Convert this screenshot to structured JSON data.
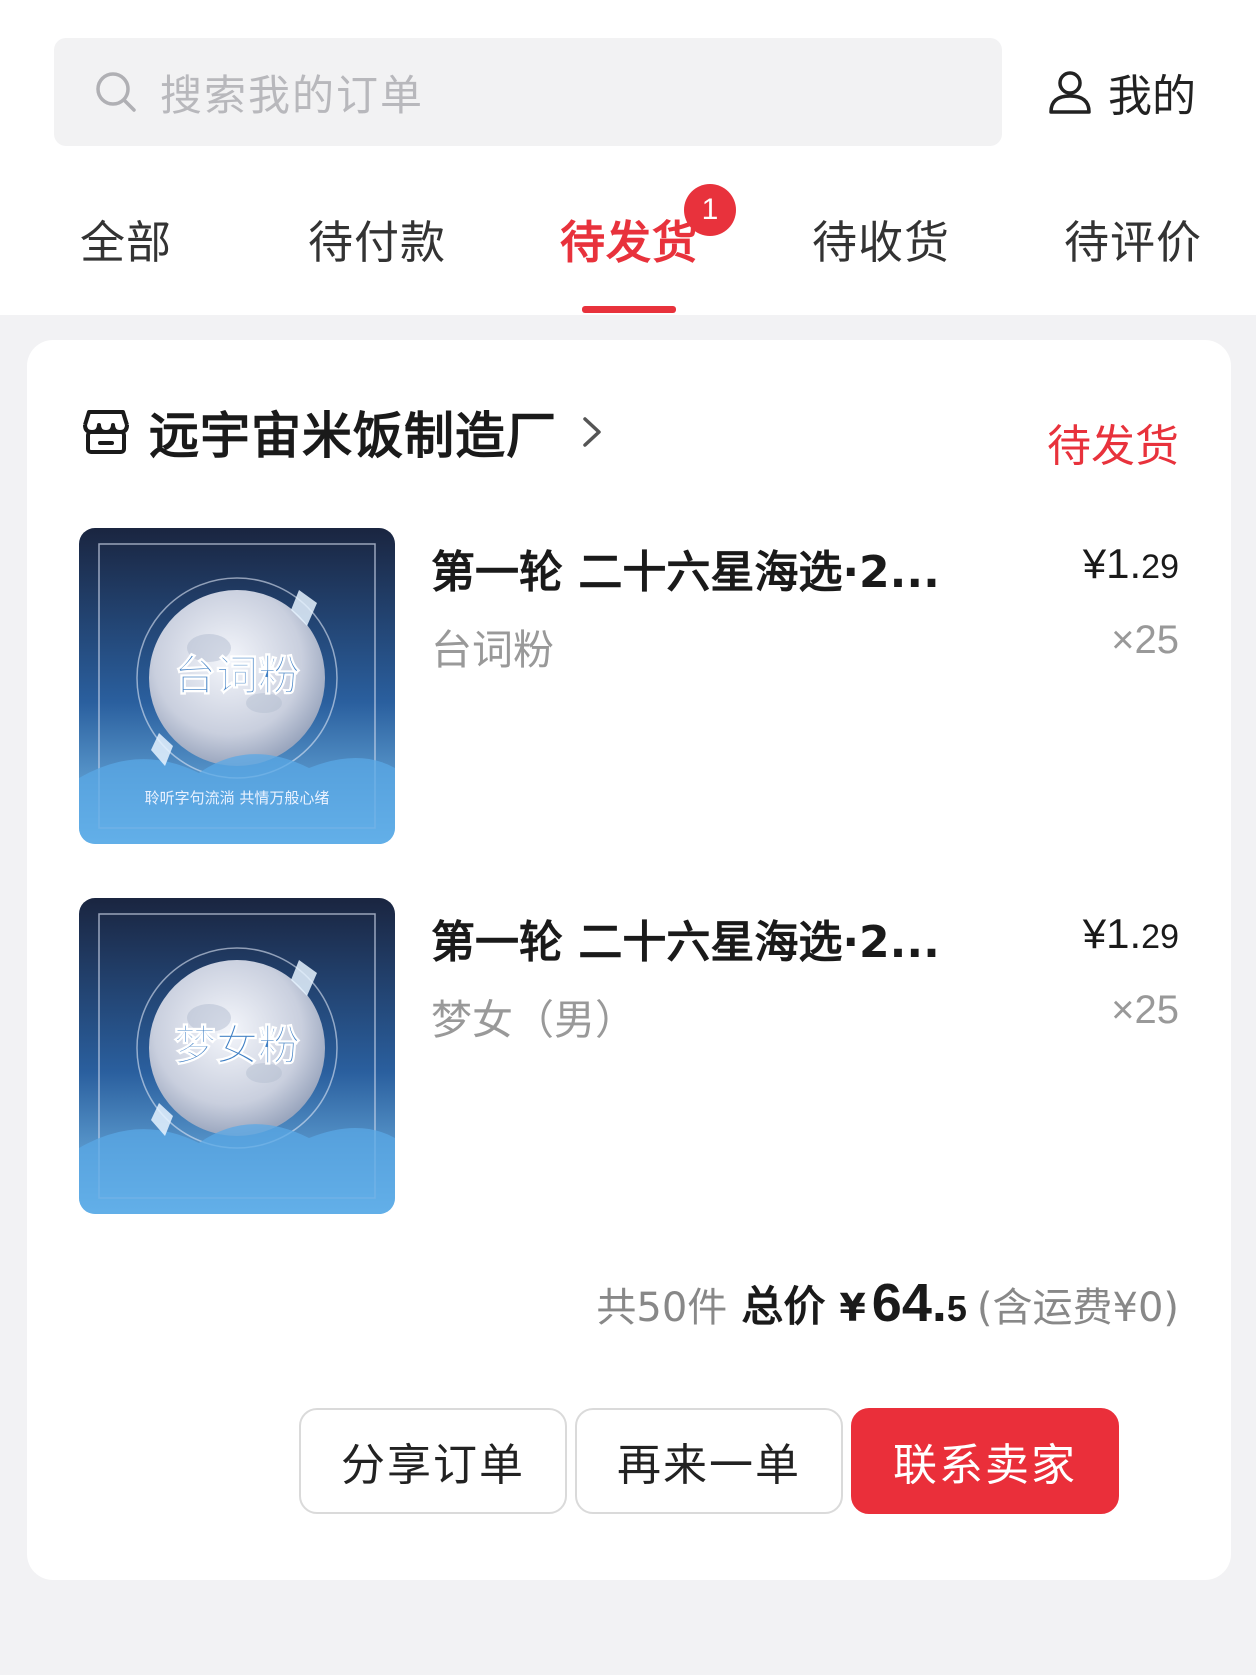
{
  "search": {
    "placeholder": "搜索我的订单",
    "icon": "search-icon"
  },
  "header": {
    "mine_label": "我的",
    "mine_icon": "user-icon"
  },
  "tabs": [
    {
      "label": "全部"
    },
    {
      "label": "待付款"
    },
    {
      "label": "待发货",
      "active": true,
      "badge": "1"
    },
    {
      "label": "待收货"
    },
    {
      "label": "待评价"
    }
  ],
  "order": {
    "shop_name": "远宇宙米饭制造厂",
    "status": "待发货",
    "items": [
      {
        "title": "第一轮 二十六星海选·2...",
        "spec": "台词粉",
        "price_prefix": "¥1.",
        "price_decimal": "29",
        "quantity": "×25",
        "image_text": "台词粉",
        "image_caption": "聆听字句流淌 共情万般心绪"
      },
      {
        "title": "第一轮 二十六星海选·2...",
        "spec": "梦女（男）",
        "price_prefix": "¥1.",
        "price_decimal": "29",
        "quantity": "×25",
        "image_text": "梦女粉"
      }
    ],
    "total": {
      "count_text": "共50件",
      "label": "总价",
      "currency": "¥",
      "amount_int": "64.",
      "amount_dec": "5",
      "shipping_text": "(含运费¥0)"
    },
    "actions": {
      "share": "分享订单",
      "reorder": "再来一单",
      "contact": "联系卖家"
    }
  },
  "colors": {
    "accent": "#e8323c",
    "page_bg": "#f2f2f4",
    "muted": "#999999"
  }
}
